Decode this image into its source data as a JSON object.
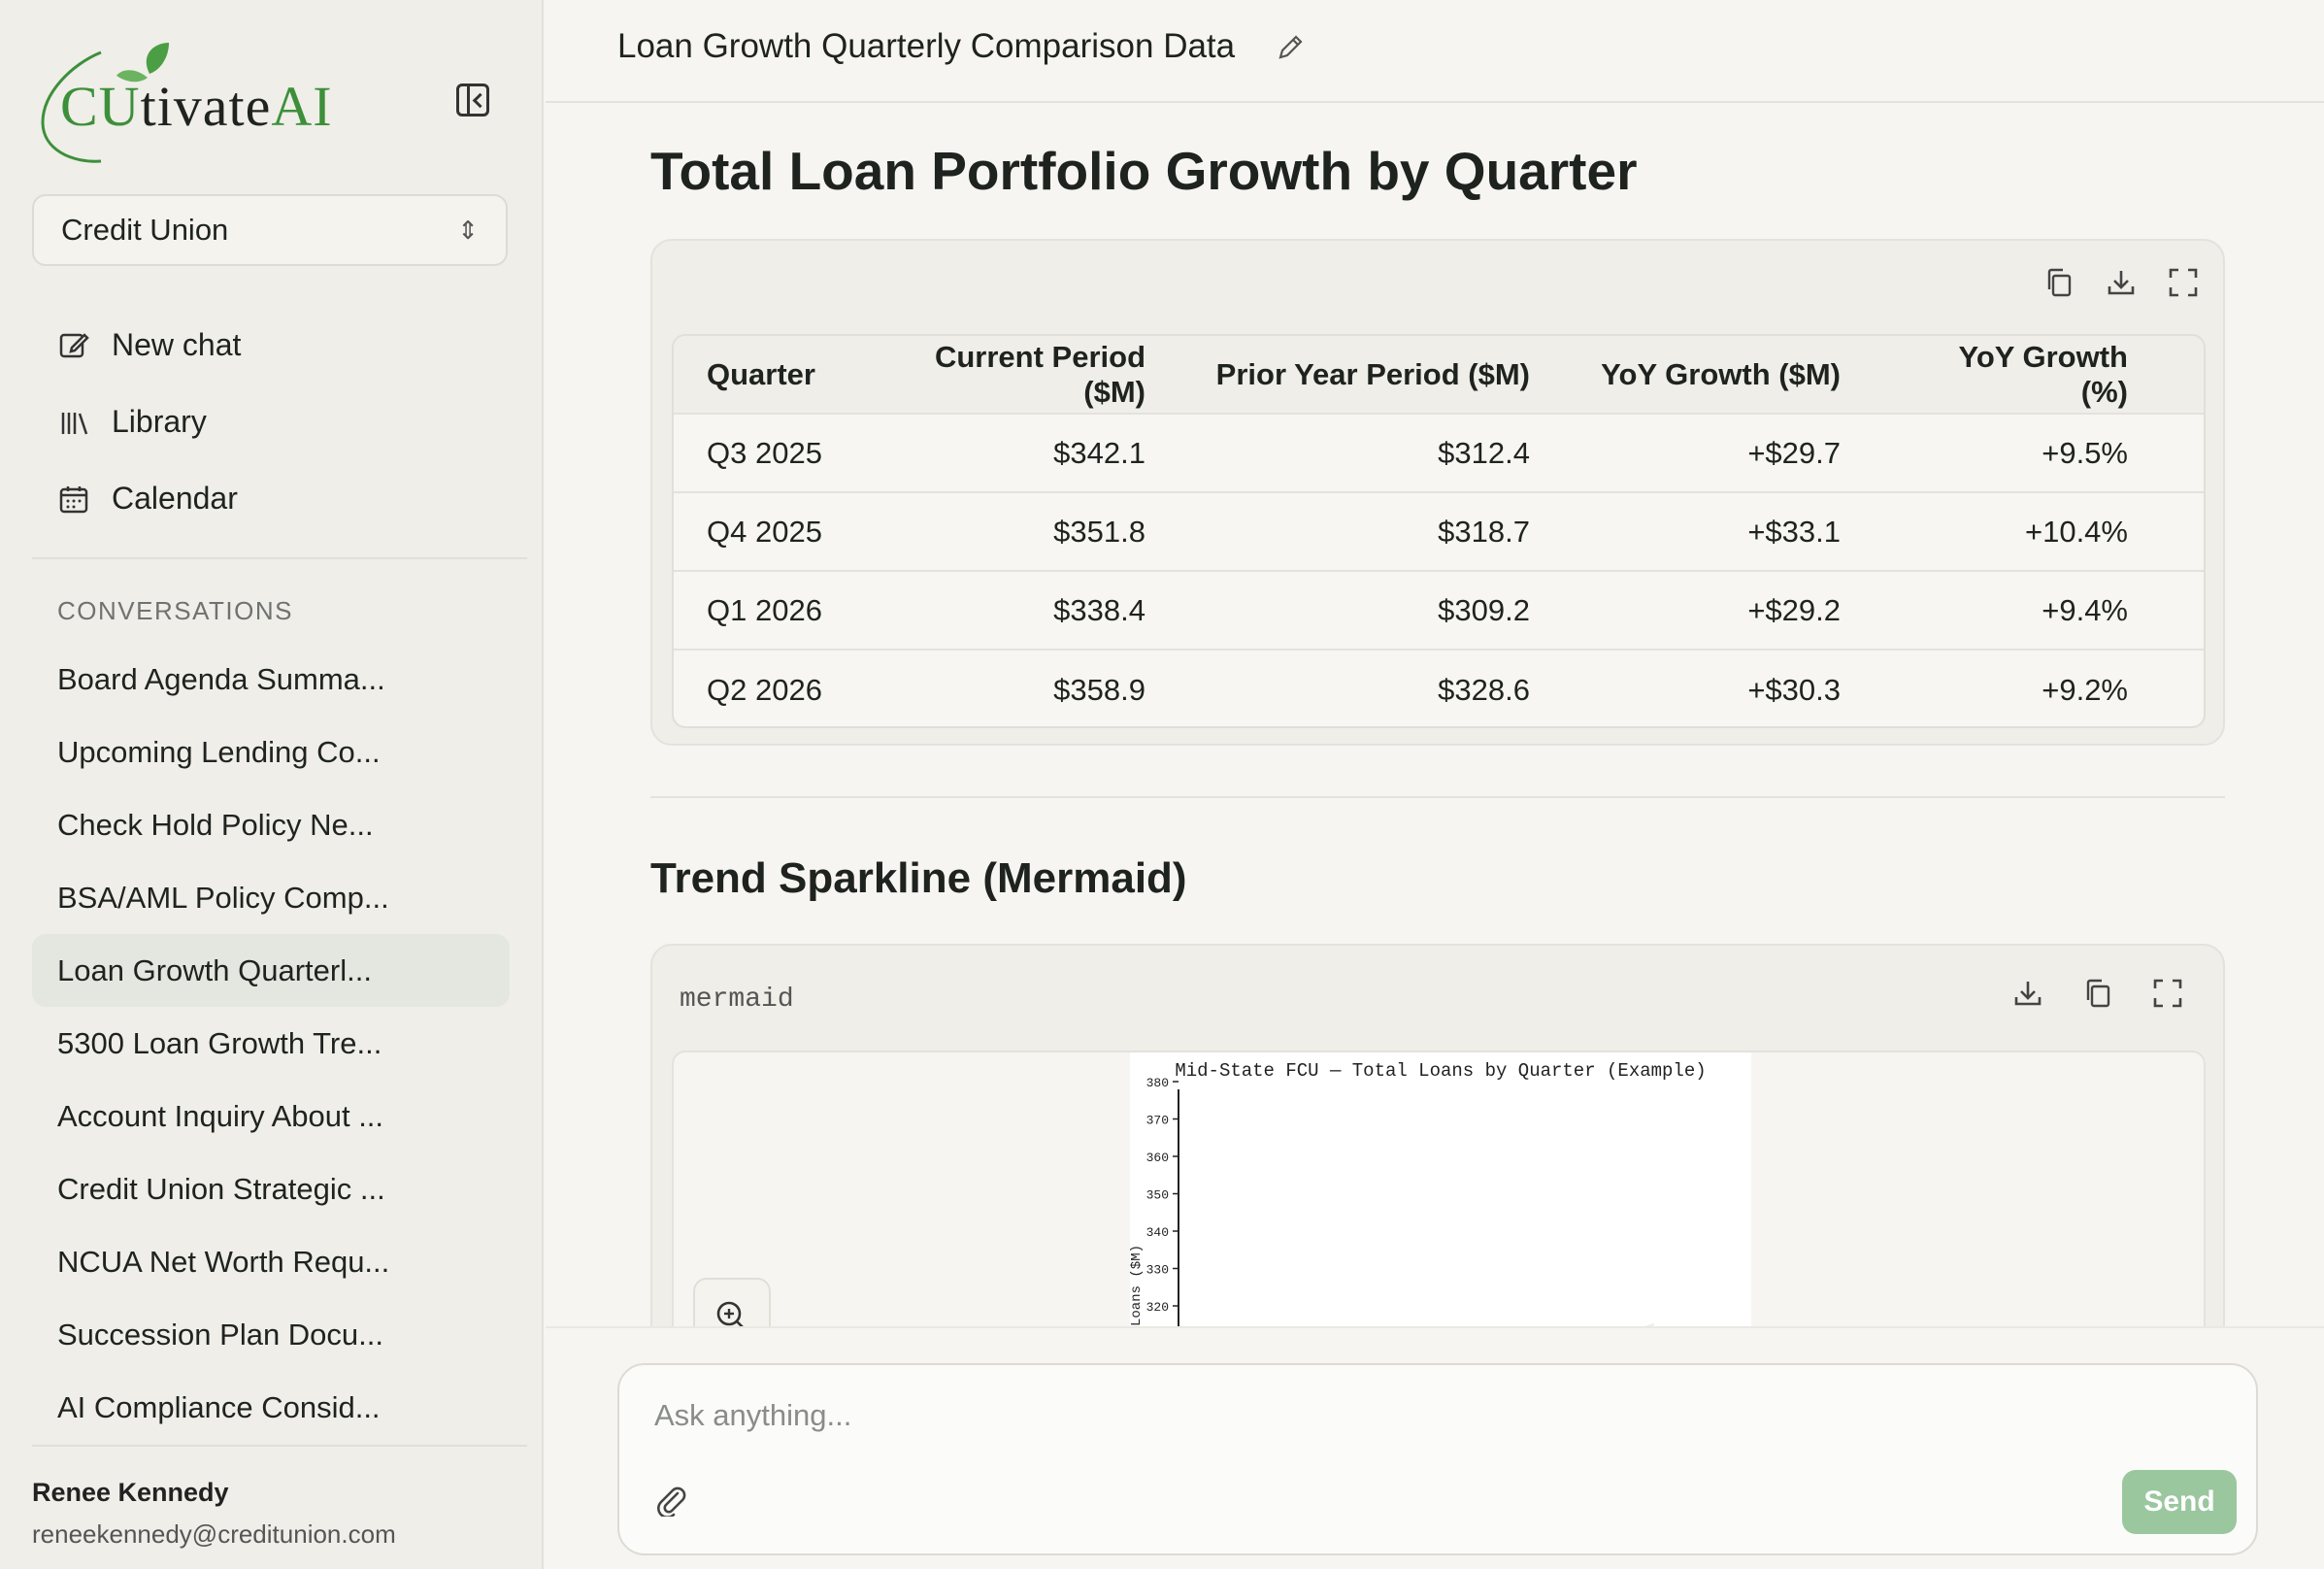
{
  "sidebar": {
    "logo": {
      "part1": "CU",
      "part2": "tivate",
      "part3": "AI"
    },
    "org_select": {
      "value": "Credit Union"
    },
    "nav": [
      {
        "label": "New chat",
        "icon": "edit-icon"
      },
      {
        "label": "Library",
        "icon": "library-icon"
      },
      {
        "label": "Calendar",
        "icon": "calendar-icon"
      }
    ],
    "conversations_header": "CONVERSATIONS",
    "conversations": [
      "Board Agenda Summa...",
      "Upcoming Lending Co...",
      "Check Hold Policy Ne...",
      "BSA/AML Policy Comp...",
      "Loan Growth Quarterl...",
      "5300 Loan Growth Tre...",
      "Account Inquiry About ...",
      "Credit Union Strategic ...",
      "NCUA Net Worth Requ...",
      "Succession Plan Docu...",
      "AI Compliance Consid..."
    ],
    "active_conversation_index": 4,
    "user": {
      "name": "Renee Kennedy",
      "email": "reneekennedy@creditunion.com"
    }
  },
  "topbar": {
    "title": "Loan Growth Quarterly Comparison Data"
  },
  "content": {
    "heading": "Total Loan Portfolio Growth by Quarter",
    "table": {
      "headers": [
        "Quarter",
        "Current Period ($M)",
        "Prior Year Period ($M)",
        "YoY Growth ($M)",
        "YoY Growth (%)"
      ],
      "rows": [
        [
          "Q3 2025",
          "$342.1",
          "$312.4",
          "+$29.7",
          "+9.5%"
        ],
        [
          "Q4 2025",
          "$351.8",
          "$318.7",
          "+$33.1",
          "+10.4%"
        ],
        [
          "Q1 2026",
          "$338.4",
          "$309.2",
          "+$29.2",
          "+9.4%"
        ],
        [
          "Q2 2026",
          "$358.9",
          "$328.6",
          "+$30.3",
          "+9.2%"
        ]
      ]
    },
    "section_heading": "Trend Sparkline (Mermaid)",
    "code_lang": "mermaid"
  },
  "chart_data": {
    "type": "line",
    "title": "Mid-State FCU — Total Loans by Quarter (Example)",
    "ylabel": "Loans ($M)",
    "ylim": [
      320,
      380
    ],
    "yticks": [
      "380",
      "370",
      "360",
      "350",
      "340",
      "330",
      "320"
    ]
  },
  "composer": {
    "placeholder": "Ask anything...",
    "send_label": "Send"
  },
  "colors": {
    "brand_green": "#3d8f3a",
    "send_button": "#9ac79e",
    "active_item": "#e3e7df"
  }
}
